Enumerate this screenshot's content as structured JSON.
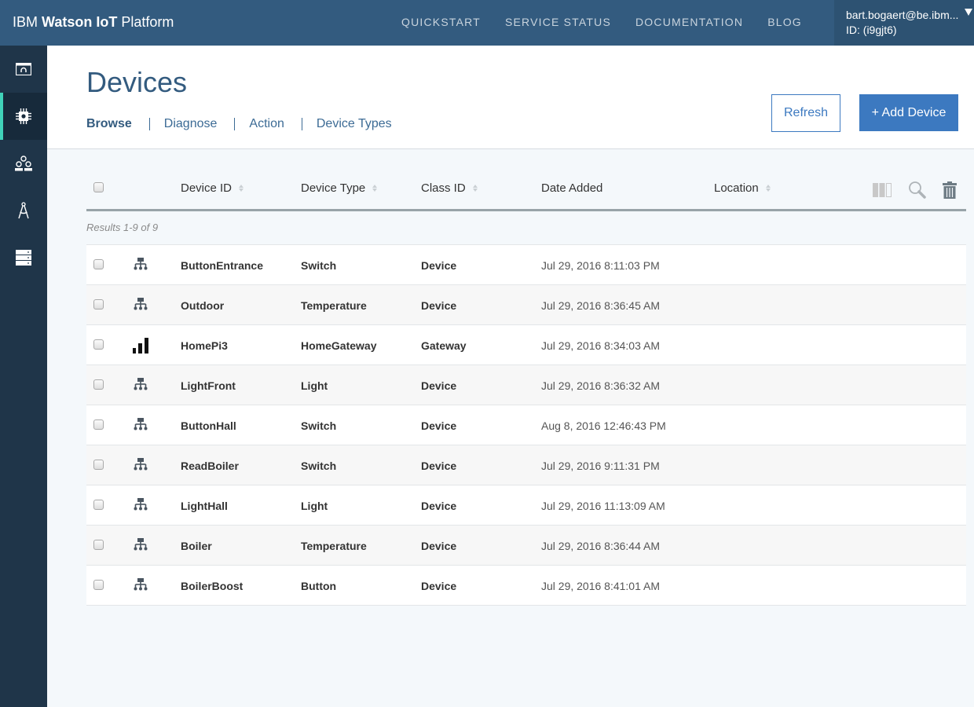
{
  "app": {
    "brand_prefix": "IBM ",
    "brand_bold": "Watson IoT",
    "brand_suffix": " Platform"
  },
  "topnav": [
    {
      "label": "QUICKSTART"
    },
    {
      "label": "SERVICE STATUS"
    },
    {
      "label": "DOCUMENTATION"
    },
    {
      "label": "BLOG"
    }
  ],
  "user": {
    "email": "bart.bogaert@be.ibm...",
    "org_id": "ID: (i9gjt6)"
  },
  "sidebar": {
    "items": [
      {
        "icon": "dashboard-icon",
        "active": false
      },
      {
        "icon": "chip-icon",
        "active": true
      },
      {
        "icon": "members-icon",
        "active": false
      },
      {
        "icon": "compass-icon",
        "active": false
      },
      {
        "icon": "server-icon",
        "active": false
      }
    ],
    "accent_color": "#40d2b9"
  },
  "page": {
    "title": "Devices",
    "tabs": [
      {
        "label": "Browse",
        "active": true
      },
      {
        "label": "Diagnose",
        "active": false
      },
      {
        "label": "Action",
        "active": false
      },
      {
        "label": "Device Types",
        "active": false
      }
    ],
    "refresh_label": "Refresh",
    "add_device_label": "+ Add Device"
  },
  "table": {
    "columns": [
      "Device ID",
      "Device Type",
      "Class ID",
      "Date Added",
      "Location"
    ],
    "results_text": "Results 1-9 of 9",
    "rows": [
      {
        "icon": "device-icon",
        "device_id": "ButtonEntrance",
        "device_type": "Switch",
        "class_id": "Device",
        "date_added": "Jul 29, 2016 8:11:03 PM",
        "location": ""
      },
      {
        "icon": "device-icon",
        "device_id": "Outdoor",
        "device_type": "Temperature",
        "class_id": "Device",
        "date_added": "Jul 29, 2016 8:36:45 AM",
        "location": ""
      },
      {
        "icon": "gateway-icon",
        "device_id": "HomePi3",
        "device_type": "HomeGateway",
        "class_id": "Gateway",
        "date_added": "Jul 29, 2016 8:34:03 AM",
        "location": ""
      },
      {
        "icon": "device-icon",
        "device_id": "LightFront",
        "device_type": "Light",
        "class_id": "Device",
        "date_added": "Jul 29, 2016 8:36:32 AM",
        "location": ""
      },
      {
        "icon": "device-icon",
        "device_id": "ButtonHall",
        "device_type": "Switch",
        "class_id": "Device",
        "date_added": "Aug 8, 2016 12:46:43 PM",
        "location": ""
      },
      {
        "icon": "device-icon",
        "device_id": "ReadBoiler",
        "device_type": "Switch",
        "class_id": "Device",
        "date_added": "Jul 29, 2016 9:11:31 PM",
        "location": ""
      },
      {
        "icon": "device-icon",
        "device_id": "LightHall",
        "device_type": "Light",
        "class_id": "Device",
        "date_added": "Jul 29, 2016 11:13:09 AM",
        "location": ""
      },
      {
        "icon": "device-icon",
        "device_id": "Boiler",
        "device_type": "Temperature",
        "class_id": "Device",
        "date_added": "Jul 29, 2016 8:36:44 AM",
        "location": ""
      },
      {
        "icon": "device-icon",
        "device_id": "BoilerBoost",
        "device_type": "Button",
        "class_id": "Device",
        "date_added": "Jul 29, 2016 8:41:01 AM",
        "location": ""
      }
    ]
  },
  "colors": {
    "topbar": "#335b7f",
    "sidebar": "#1f3549",
    "primary": "#3c79c0"
  }
}
